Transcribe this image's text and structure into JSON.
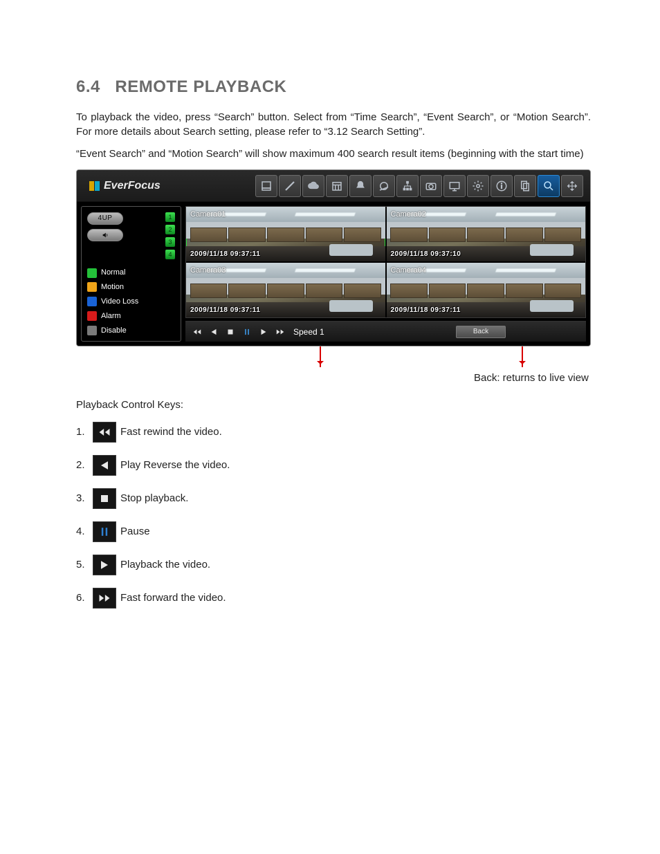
{
  "section": {
    "number": "6.4",
    "title": "REMOTE PLAYBACK"
  },
  "paragraphs": {
    "p1": "To playback the video, press “Search” button. Select from “Time Search”, “Event Search”, or “Motion Search”.  For more details about Search setting, please refer to “3.12 Search Setting”.",
    "p2": "“Event Search” and “Motion Search” will show maximum 400 search result items (beginning with the start time)"
  },
  "app": {
    "brand": "EverFocus",
    "sidebar": {
      "four_up": "4UP",
      "cam_nums": [
        "1",
        "2",
        "3",
        "4"
      ],
      "legend": {
        "normal": "Normal",
        "motion": "Motion",
        "video_loss": "Video Loss",
        "alarm": "Alarm",
        "disable": "Disable"
      }
    },
    "cameras": [
      {
        "name": "Camera01",
        "ts": "2009/11/18  09:37:11"
      },
      {
        "name": "Camera02",
        "ts": "2009/11/18  09:37:10"
      },
      {
        "name": "Camera03",
        "ts": "2009/11/18  09:37:11"
      },
      {
        "name": "Camera04",
        "ts": "2009/11/18  09:37:11"
      }
    ],
    "playbar": {
      "speed": "Speed 1",
      "back": "Back"
    }
  },
  "annotations": {
    "back_caption": "Back: returns to live view",
    "keys_title": "Playback Control Keys:"
  },
  "keys": [
    {
      "n": "1.",
      "text": " Fast rewind the video."
    },
    {
      "n": "2.",
      "text": " Play Reverse the video."
    },
    {
      "n": "3.",
      "text": " Stop playback."
    },
    {
      "n": "4.",
      "text": " Pause"
    },
    {
      "n": "5.",
      "text": " Playback the video."
    },
    {
      "n": "6.",
      "text": " Fast forward the video."
    }
  ]
}
